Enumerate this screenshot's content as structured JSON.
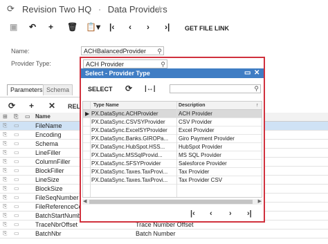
{
  "header": {
    "title": "Revision Two HQ",
    "separator": "·",
    "page": "Data Providers"
  },
  "toolbar": {
    "get_file_link": "GET FILE LINK"
  },
  "form": {
    "name_label": "Name:",
    "name_value": "ACHBalancedProvider",
    "provider_type_label": "Provider Type:",
    "provider_type_value": "ACH Provider"
  },
  "tabs": {
    "parameters": "Parameters",
    "schema": "Schema"
  },
  "grid_toolbar": {
    "reload_partial": "REL"
  },
  "grid": {
    "name_header": "Name",
    "rows": [
      {
        "name": "FileName",
        "desc": ""
      },
      {
        "name": "Encoding",
        "desc": ""
      },
      {
        "name": "Schema",
        "desc": ""
      },
      {
        "name": "LineFiller",
        "desc": ""
      },
      {
        "name": "ColumnFiller",
        "desc": ""
      },
      {
        "name": "BlockFiller",
        "desc": ""
      },
      {
        "name": "LineSize",
        "desc": ""
      },
      {
        "name": "BlockSize",
        "desc": ""
      },
      {
        "name": "FileSeqNumber",
        "desc": ""
      },
      {
        "name": "FileReferenceCod",
        "desc": ""
      },
      {
        "name": "BatchStartNumbe",
        "desc": ""
      },
      {
        "name": "TraceNbrOffset",
        "desc": "Trace Number Offset"
      },
      {
        "name": "BatchNbr",
        "desc": "Batch Number"
      }
    ]
  },
  "dialog": {
    "title": "Select - Provider Type",
    "select_label": "SELECT",
    "col_type_name": "Type Name",
    "col_description": "Description",
    "rows": [
      {
        "type": "PX.DataSync.ACHProvider",
        "desc": "ACH Provider"
      },
      {
        "type": "PX.DataSync.CSVSYProvider",
        "desc": "CSV Provider"
      },
      {
        "type": "PX.DataSync.ExcelSYProvider",
        "desc": "Excel Provider"
      },
      {
        "type": "PX.DataSync.Banks.GIROPa...",
        "desc": "Giro Payment Provider"
      },
      {
        "type": "PX.DataSync.HubSpot.HSS...",
        "desc": "HubSpot Provider"
      },
      {
        "type": "PX.DataSync.MSSqlProvid...",
        "desc": "MS SQL Provider"
      },
      {
        "type": "PX.DataSync.SFSYProvider",
        "desc": "Salesforce Provider"
      },
      {
        "type": "PX.DataSync.Taxes.TaxProvi...",
        "desc": "Tax Provider"
      },
      {
        "type": "PX.DataSync.Taxes.TaxProvi...",
        "desc": "Tax Provider CSV"
      }
    ]
  },
  "colors": {
    "accent": "#3f7dc4",
    "highlight_border": "#d0303c",
    "selected_row": "#d9d9d9"
  }
}
